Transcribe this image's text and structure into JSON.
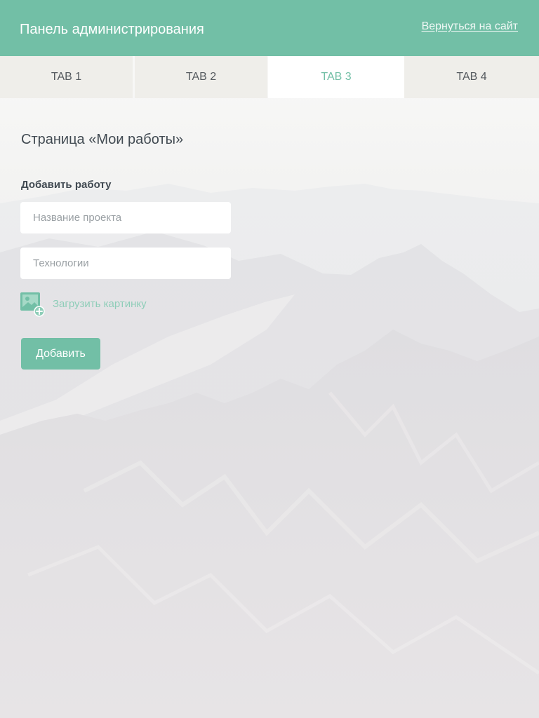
{
  "header": {
    "title": "Панель администрирования",
    "back_link": "Вернуться на сайт"
  },
  "tabs": [
    {
      "label": "TAB 1",
      "active": false
    },
    {
      "label": "TAB 2",
      "active": false
    },
    {
      "label": "TAB 3",
      "active": true
    },
    {
      "label": "TAB 4",
      "active": false
    }
  ],
  "page": {
    "title": "Страница «Мои работы»"
  },
  "form": {
    "section_title": "Добавить работу",
    "project_name": {
      "value": "",
      "placeholder": "Название проекта"
    },
    "technologies": {
      "value": "",
      "placeholder": "Технологии"
    },
    "upload_label": "Загрузить картинку",
    "submit_label": "Добавить"
  },
  "colors": {
    "accent": "#72bfa6",
    "tab_bg": "#efeeea",
    "tab_active_bg": "#ffffff",
    "text_dark": "#414a52",
    "upload_text": "#8ecdb8"
  },
  "icons": {
    "upload": "image-add-icon",
    "background": "mountains-background"
  }
}
